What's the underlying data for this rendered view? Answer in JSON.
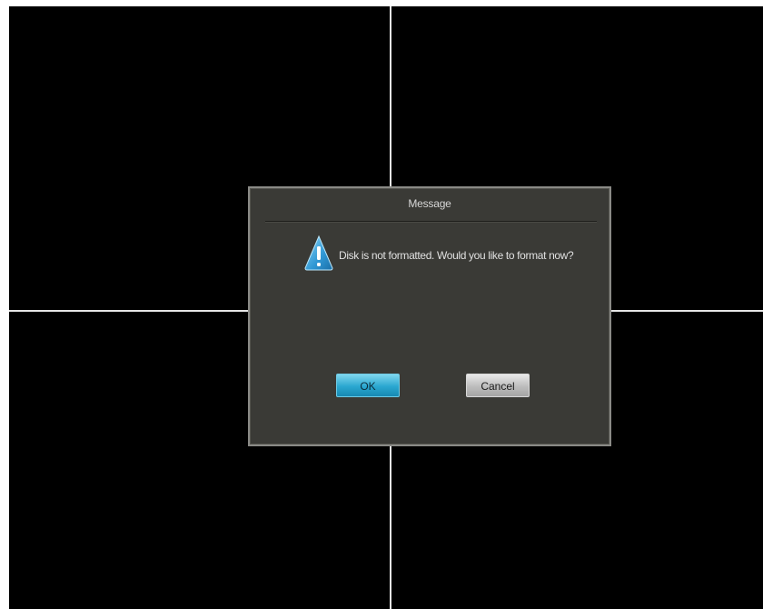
{
  "dialog": {
    "title": "Message",
    "message": "Disk is not formatted. Would you like to format now?",
    "icon": "warning-icon",
    "buttons": {
      "ok_label": "OK",
      "cancel_label": "Cancel"
    }
  },
  "colors": {
    "dialog_bg": "#3a3a36",
    "ok_button": "#2aa7d0",
    "cancel_button": "#bdbdbd",
    "warning_icon": "#3aa0d8"
  }
}
